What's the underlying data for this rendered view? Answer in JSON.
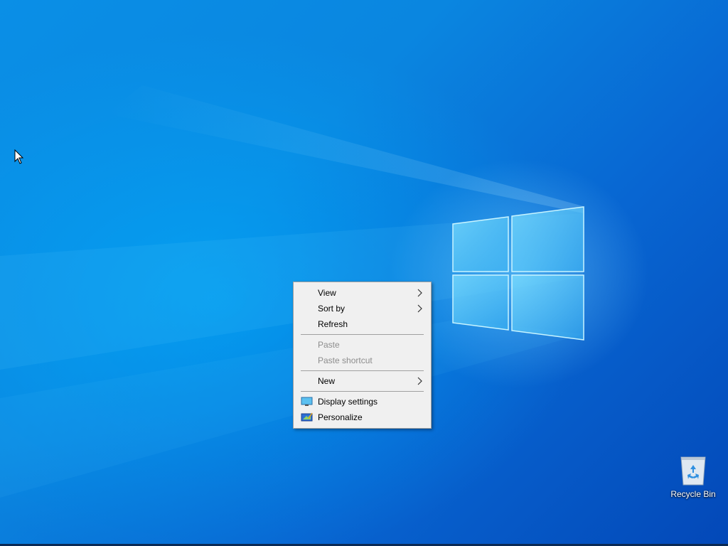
{
  "context_menu": {
    "items": [
      {
        "label": "View",
        "submenu": true,
        "enabled": true
      },
      {
        "label": "Sort by",
        "submenu": true,
        "enabled": true
      },
      {
        "label": "Refresh",
        "submenu": false,
        "enabled": true
      },
      {
        "label": "Paste",
        "submenu": false,
        "enabled": false
      },
      {
        "label": "Paste shortcut",
        "submenu": false,
        "enabled": false
      },
      {
        "label": "New",
        "submenu": true,
        "enabled": true
      },
      {
        "label": "Display settings",
        "submenu": false,
        "enabled": true,
        "icon": "display-settings-icon"
      },
      {
        "label": "Personalize",
        "submenu": false,
        "enabled": true,
        "icon": "personalize-icon"
      }
    ]
  },
  "desktop_icons": {
    "recycle_bin": {
      "label": "Recycle Bin",
      "icon": "recycle-bin-icon"
    }
  },
  "colors": {
    "menu_background": "#f0f0f0",
    "menu_disabled_text": "#8d8d8d",
    "desktop_accent": "#0a86e0"
  }
}
